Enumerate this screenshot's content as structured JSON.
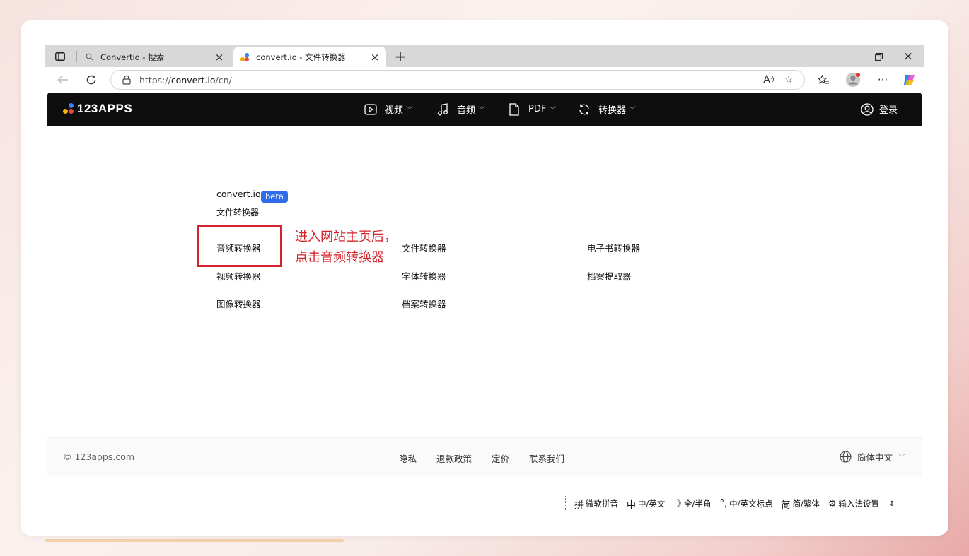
{
  "browser": {
    "tabs": [
      {
        "title": "Convertio - 搜索",
        "active": false
      },
      {
        "title": "convert.io - 文件转换器",
        "active": true
      }
    ],
    "url_prefix": "https://",
    "url_host": "convert.io",
    "url_path": "/cn/"
  },
  "header": {
    "logo_text": "123APPS",
    "menu": [
      {
        "label": "视频"
      },
      {
        "label": "音频"
      },
      {
        "label": "PDF"
      },
      {
        "label": "转换器"
      }
    ],
    "login_label": "登录"
  },
  "main": {
    "brand_name": "convert.io",
    "beta_label": "beta",
    "brand_subtitle": "文件转换器",
    "converters": {
      "col1": [
        "音频转换器",
        "视频转换器",
        "图像转换器"
      ],
      "col2": [
        "文件转换器",
        "字体转换器",
        "档案转换器"
      ],
      "col3": [
        "电子书转换器",
        "档案提取器"
      ]
    },
    "annotation_line1": "进入网站主页后，",
    "annotation_line2": "点击音频转换器"
  },
  "footer": {
    "copyright": "© 123apps.com",
    "links": [
      "隐私",
      "退款政策",
      "定价",
      "联系我们"
    ],
    "language": "简体中文"
  },
  "ime": {
    "items": [
      "微软拼音",
      "中/英文",
      "全/半角",
      "中/英文标点",
      "简/繁体",
      "输入法设置"
    ],
    "item_icons": [
      "拼",
      "中",
      "☽",
      "°,",
      "简",
      "⚙"
    ]
  },
  "colors": {
    "header_bg": "#0e0e0e",
    "beta_bg": "#2f6bea",
    "annotation": "#d4232a"
  }
}
